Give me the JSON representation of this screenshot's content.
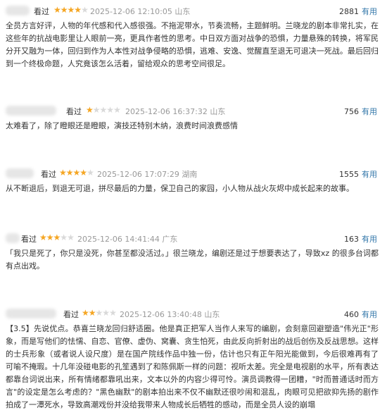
{
  "reviews": [
    {
      "seen": "看过",
      "rating": 4,
      "time": "2025-12-06 12:10:05 山东",
      "useful_count": "2881",
      "useful_label": "有用",
      "content": "全员方言好评，人物的年代感和代入感很强。不拖泥带水，节奏流畅，主题鲜明。兰晓龙的剧本非常扎实，在这些年的抗战电影里让人眼前一亮，更具作者性的思考。中日双方面对战争的恐惧，力量悬殊的转换，将军民分开又融为一体，回归到作为人本性对战争侵略的恐惧，逃难、安逸、觉醒直至退无可退决一死战。最后回归到一个终极命题，人究竟该怎么活着，留给观众的思考空间很足。"
    },
    {
      "seen": "看过",
      "rating": 1,
      "time": "2025-12-06 16:37:32 山东",
      "useful_count": "756",
      "useful_label": "有用",
      "content": "太难看了，除了瞪眼还是瞪眼，演技还特别木纳，浪费时间浪费感情"
    },
    {
      "seen": "看过",
      "rating": 4,
      "time": "2025-12-06 17:07:29 湖南",
      "useful_count": "1555",
      "useful_label": "有用",
      "content": "从不断退后，到退无可退，拼尽最后的力量，保卫自己的家园，小人物从战火灰烬中成长起来的故事。"
    },
    {
      "seen": "看过",
      "rating": 3,
      "time": "2025-12-06 14:41:44 广东",
      "useful_count": "163",
      "useful_label": "有用",
      "content": "「我只是死了，你只是没死，你甚至都没活过。」很兰晓龙，编剧还是过于想要表达了，导致xz 的很多台词都有点出戏。"
    },
    {
      "seen": "看过",
      "rating": 2,
      "time": "2025-12-06 13:40:48 山东",
      "useful_count": "460",
      "useful_label": "有用",
      "content": "【3.5】先说优点。恭喜兰晓龙回归舒适圈。他是真正把军人当作人来写的编剧，会刻意回避塑造\"伟光正\"形象，而是写他们的怯懦、自恋、官僚、虚伪、窝囊、贪生怕死，由此反向折射出的战后创伤及反战思想。这样的士兵形象（或者说人设尺度）是在国产院线作品中独一份，估计也只有正午阳光能做到，今后很难再有了 可喻不掩瑕。十几年没碰电影的孔笙遇到了和陈佩斯一样的问题：视听太差。完全是电视剧的水平，所有表达都靠台词说出来，所有情绪都靠吼出来，文本以外的内容少得可怜。演员调教得一团糟，\"时而普通话时而方言\"的设定是怎么考虑的？\"黑色幽默\"的剧本拍出来不仅不幽默还很吵闹和混乱，肉眼可见把欲抑先扬的剧作拍成了一潭死水，导致高潮戏份并没给我带来人物成长后牺牲的感动，而是全员人设的崩塌"
    }
  ]
}
